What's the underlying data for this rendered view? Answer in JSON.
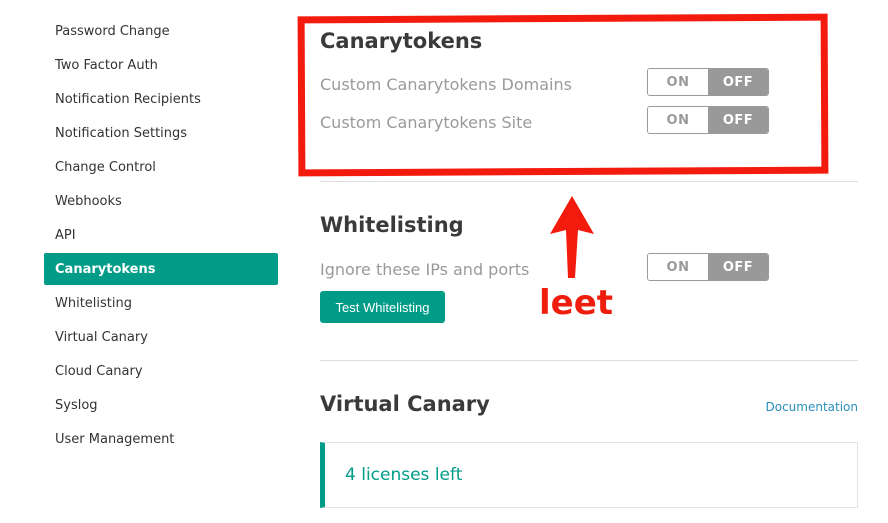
{
  "sidebar": {
    "items": [
      {
        "label": "Password Change"
      },
      {
        "label": "Two Factor Auth"
      },
      {
        "label": "Notification Recipients"
      },
      {
        "label": "Notification Settings"
      },
      {
        "label": "Change Control"
      },
      {
        "label": "Webhooks"
      },
      {
        "label": "API"
      },
      {
        "label": "Canarytokens",
        "active": true
      },
      {
        "label": "Whitelisting"
      },
      {
        "label": "Virtual Canary"
      },
      {
        "label": "Cloud Canary"
      },
      {
        "label": "Syslog"
      },
      {
        "label": "User Management"
      }
    ]
  },
  "canarytokens": {
    "title": "Canarytokens",
    "settings": [
      {
        "label": "Custom Canarytokens Domains",
        "on_label": "ON",
        "off_label": "OFF",
        "state": "OFF"
      },
      {
        "label": "Custom Canarytokens Site",
        "on_label": "ON",
        "off_label": "OFF",
        "state": "OFF"
      }
    ]
  },
  "whitelisting": {
    "title": "Whitelisting",
    "setting": {
      "label": "Ignore these IPs and ports",
      "on_label": "ON",
      "off_label": "OFF",
      "state": "OFF"
    },
    "test_button": "Test Whitelisting"
  },
  "virtual_canary": {
    "title": "Virtual Canary",
    "doc_link": "Documentation",
    "licenses": "4 licenses left"
  },
  "annotation": {
    "text": "leet",
    "color": "#f31b0e"
  },
  "colors": {
    "accent": "#009c88",
    "link": "#2a8fbd",
    "toggle_off_bg": "#999999"
  }
}
